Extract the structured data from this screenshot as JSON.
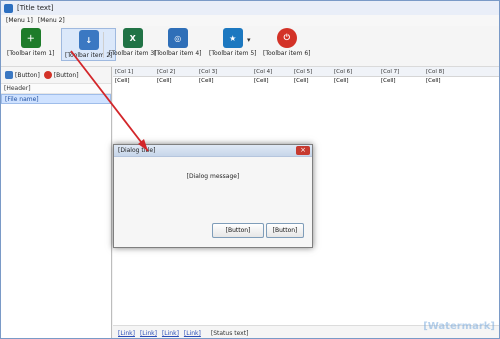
{
  "window": {
    "title": "[Title text]",
    "menus": [
      "[Menu 1]",
      "[Menu 2]"
    ]
  },
  "toolbar": {
    "buttons": [
      {
        "label": "[Toolbar item 1]",
        "icon": "add-list-icon",
        "color": "#1e7c2a"
      },
      {
        "label": "[Toolbar item 2]",
        "icon": "export-icon",
        "color": "#3b78c2"
      },
      {
        "label": "[Toolbar item 3]",
        "icon": "excel-icon",
        "color": "#217346"
      },
      {
        "label": "[Toolbar item 4]",
        "icon": "online-icon",
        "color": "#2f6fb8"
      },
      {
        "label": "[Toolbar item 5]",
        "icon": "recommend-icon",
        "color": "#1c78c0"
      },
      {
        "label": "[Toolbar item 6]",
        "icon": "power-icon",
        "color": "#d33227"
      }
    ]
  },
  "left": {
    "open_btn": "[Button]",
    "remove_btn": "[Button]",
    "col_filename": "[Header]",
    "file": "[File name]"
  },
  "grid": {
    "headers": [
      "[Col 1]",
      "[Col 2]",
      "[Col 3]",
      "[Col 4]",
      "[Col 5]",
      "[Col 6]",
      "[Col 7]",
      "[Col 8]"
    ],
    "rows": [
      [
        "[Cell]",
        "[Cell]",
        "[Cell]",
        "[Cell]",
        "[Cell]",
        "[Cell]",
        "[Cell]",
        "[Cell]"
      ]
    ]
  },
  "pager": {
    "first": "[Link]",
    "prev": "[Link]",
    "next": "[Link]",
    "last": "[Link]",
    "info": "[Status text]"
  },
  "dialog": {
    "title": "[Dialog title]",
    "message": "[Dialog message]",
    "ok": "[Button]",
    "cancel": "[Button]"
  },
  "watermark": "[Watermark]"
}
